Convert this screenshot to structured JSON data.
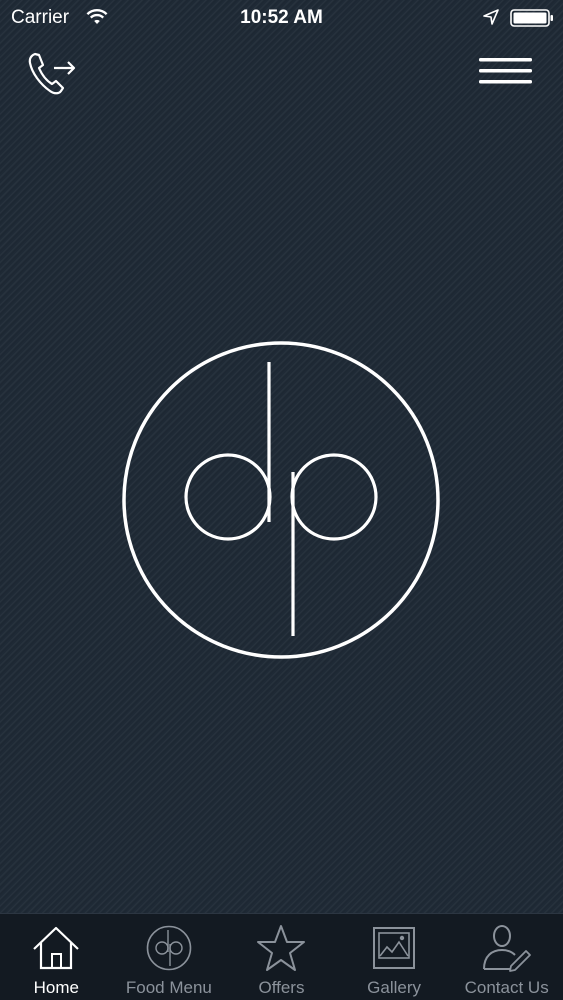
{
  "status_bar": {
    "carrier": "Carrier",
    "time": "10:52 AM"
  },
  "header": {
    "call_icon": "phone-outgoing-icon",
    "menu_icon": "hamburger-menu-icon"
  },
  "logo": {
    "icon": "dp-monogram-logo"
  },
  "tabs": [
    {
      "label": "Home",
      "icon": "home-icon",
      "active": true
    },
    {
      "label": "Food Menu",
      "icon": "dp-logo-icon",
      "active": false
    },
    {
      "label": "Offers",
      "icon": "star-icon",
      "active": false
    },
    {
      "label": "Gallery",
      "icon": "gallery-icon",
      "active": false
    },
    {
      "label": "Contact Us",
      "icon": "contact-user-icon",
      "active": false
    }
  ],
  "colors": {
    "background": "#1f2a36",
    "tab_bar": "#131a22",
    "active": "#ffffff",
    "inactive": "#8b929b"
  }
}
